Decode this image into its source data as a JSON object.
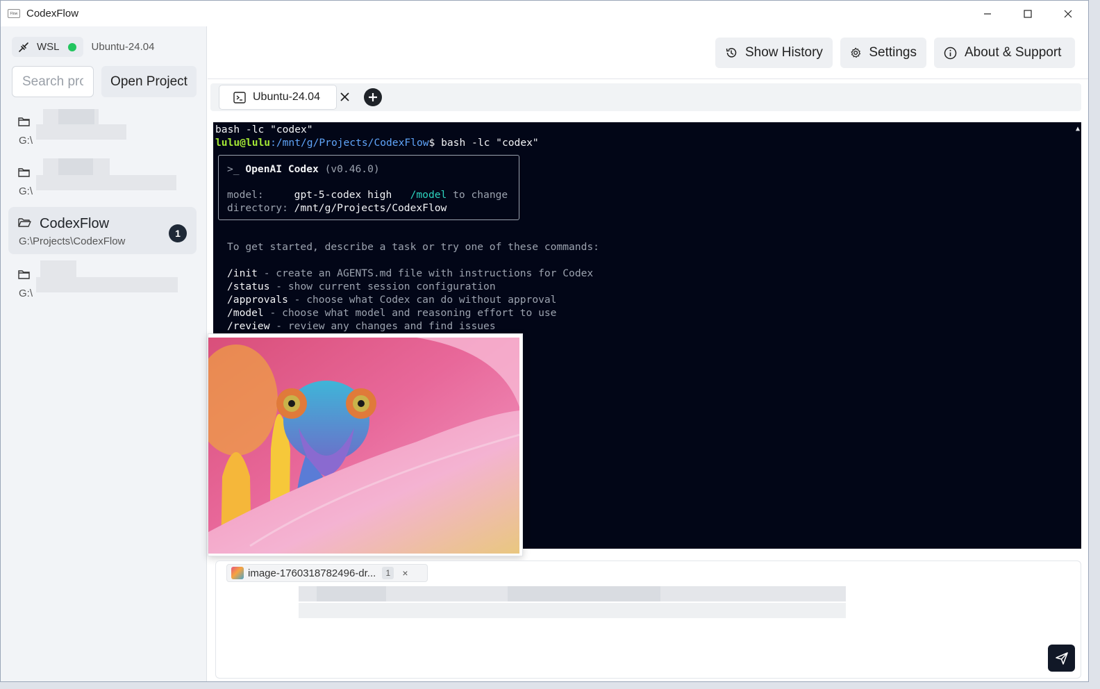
{
  "window": {
    "app_icon_text": "Flow",
    "title": "CodexFlow",
    "controls": [
      "minimize-icon",
      "maximize-icon",
      "close-icon"
    ]
  },
  "sidebar": {
    "env_label": "WSL",
    "env_status_color": "#22c55e",
    "distro": "Ubuntu-24.04",
    "search_placeholder": "Search pro",
    "open_project_label": "Open Project",
    "projects": [
      {
        "name": "",
        "path": "G:\\",
        "redacted": true
      },
      {
        "name": "",
        "path": "G:\\",
        "redacted": true
      },
      {
        "name": "CodexFlow",
        "path": "G:\\Projects\\CodexFlow",
        "badge": "1",
        "active": true
      },
      {
        "name": "",
        "path": "G:\\",
        "redacted": true
      }
    ]
  },
  "toolbar": {
    "history_label": "Show History",
    "settings_label": "Settings",
    "about_label": "About & Support"
  },
  "tabs": {
    "items": [
      {
        "label": "Ubuntu-24.04",
        "icon": "terminal-icon"
      }
    ]
  },
  "terminal": {
    "line1": "bash -lc \"codex\"",
    "prompt_user": "lulu@lulu",
    "prompt_path": ":/mnt/g/Projects/CodexFlow",
    "prompt_cmd": "$ bash -lc \"codex\"",
    "box_prefix": ">_ ",
    "box_title": "OpenAI Codex",
    "box_version": " (v0.46.0)",
    "model_key": "model:     ",
    "model_value": "gpt-5-codex high",
    "model_hint_cmd": "   /model",
    "model_hint_text": " to change",
    "dir_key": "directory: ",
    "dir_value": "/mnt/g/Projects/CodexFlow",
    "intro": "To get started, describe a task or try one of these commands:",
    "commands": [
      {
        "cmd": "/init",
        "desc": " - create an AGENTS.md file with instructions for Codex"
      },
      {
        "cmd": "/status",
        "desc": " - show current session configuration"
      },
      {
        "cmd": "/approvals",
        "desc": " - choose what Codex can do without approval"
      },
      {
        "cmd": "/model",
        "desc": " - choose what model and reasoning effort to use"
      },
      {
        "cmd": "/review",
        "desc": " - review any changes and find issues"
      }
    ]
  },
  "composer": {
    "attachment_name": "image-1760318782496-dr...",
    "attachment_count": "1",
    "attachment_remove": "×"
  }
}
